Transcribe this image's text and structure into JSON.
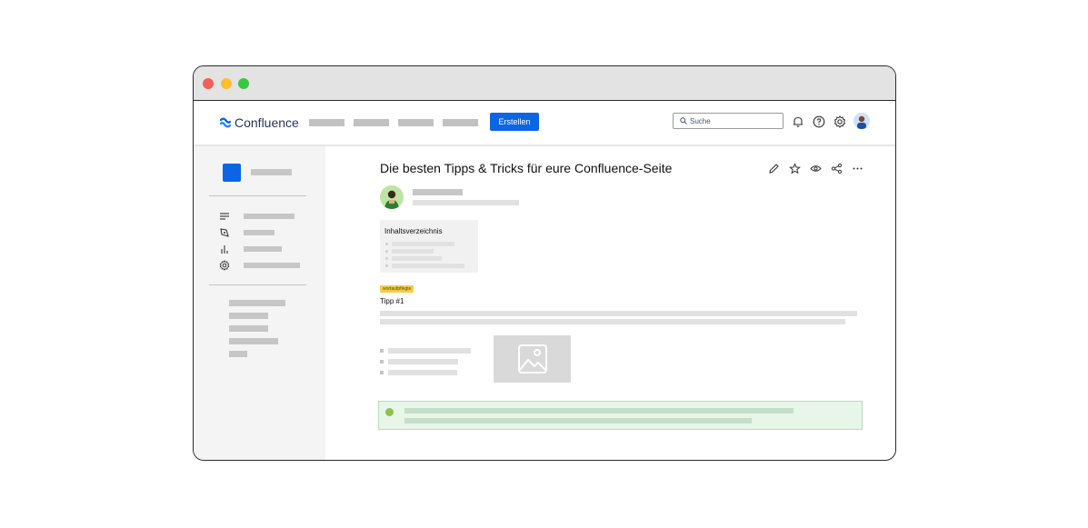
{
  "app": {
    "name": "Confluence",
    "brand_color": "#0c66e4"
  },
  "header": {
    "create_label": "Erstellen",
    "search": {
      "placeholder": "Suche"
    },
    "icons": [
      "bell-icon",
      "help-icon",
      "settings-gear-icon",
      "user-avatar"
    ]
  },
  "page": {
    "title": "Die besten Tipps & Tricks für eure Confluence-Seite",
    "actions": [
      "edit-icon",
      "star-icon",
      "watch-icon",
      "share-icon",
      "more-icon"
    ],
    "toc_title": "Inhaltsverzeichnis",
    "status_badge": "wortaufpflegte",
    "tip_heading": "Tipp #1"
  },
  "sidebar": {
    "icons": [
      "pages-icon",
      "blog-icon",
      "analytics-icon",
      "space-settings-icon"
    ]
  }
}
